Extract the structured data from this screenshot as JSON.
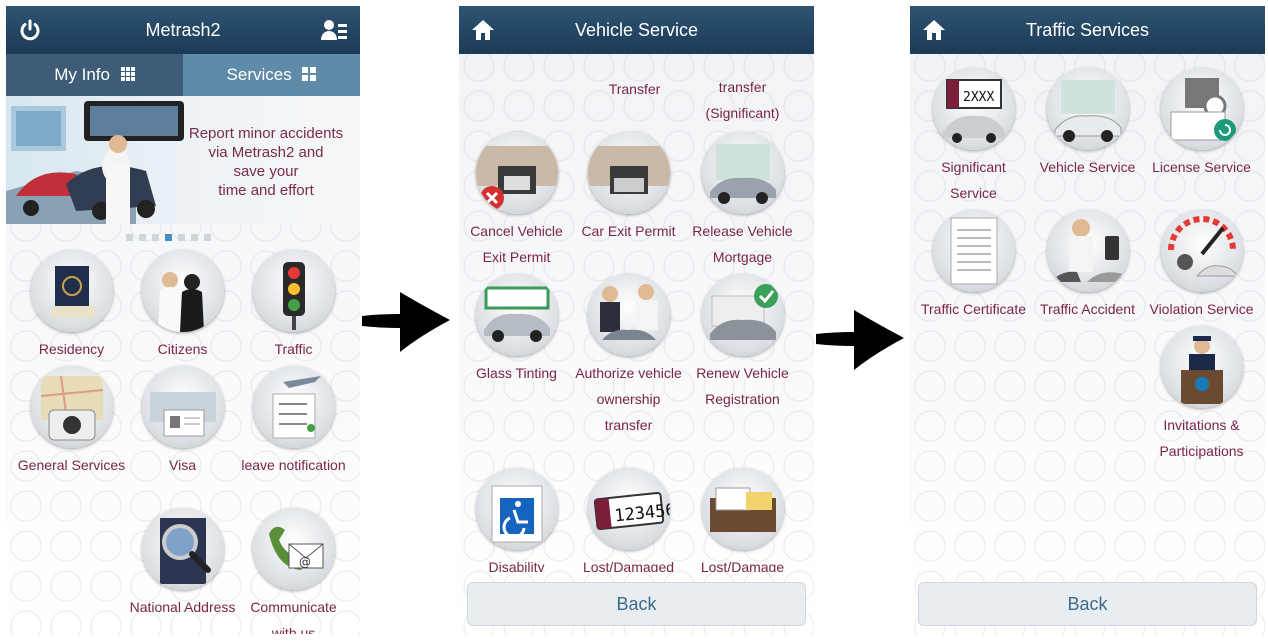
{
  "screen1": {
    "title": "Metrash2",
    "tabs": [
      {
        "label": "My Info"
      },
      {
        "label": "Services"
      }
    ],
    "banner": {
      "text_lines": [
        "Report minor accidents",
        "via Metrash2 and",
        "save your",
        "time and effort"
      ]
    },
    "items": [
      {
        "label": "Residency"
      },
      {
        "label": "Citizens"
      },
      {
        "label": "Traffic"
      },
      {
        "label": "General Services"
      },
      {
        "label": "Visa"
      },
      {
        "label": "leave notification"
      },
      {
        "label": "National Address"
      },
      {
        "label": "Communicate with us"
      }
    ]
  },
  "screen2": {
    "title": "Vehicle Service",
    "top_partial": [
      "Transfer",
      "transfer (Significant)"
    ],
    "items": [
      {
        "label": "Cancel Vehicle Exit Permit"
      },
      {
        "label": "Car Exit Permit"
      },
      {
        "label": "Release Vehicle Mortgage"
      },
      {
        "label": "Glass Tinting"
      },
      {
        "label": "Authorize vehicle ownership transfer"
      },
      {
        "label": "Renew Vehicle Registration"
      },
      {
        "label": "Disability"
      },
      {
        "label": "Lost/Damaged"
      },
      {
        "label": "Lost/Damage"
      }
    ],
    "back_label": "Back"
  },
  "screen3": {
    "title": "Traffic Services",
    "items": [
      {
        "label": "Significant Service"
      },
      {
        "label": "Vehicle Service"
      },
      {
        "label": "License Service"
      },
      {
        "label": "Traffic Certificate"
      },
      {
        "label": "Traffic Accident"
      },
      {
        "label": "Violation Service"
      },
      {
        "label": "Invitations & Participations"
      }
    ],
    "plate_text": "2XXX",
    "back_label": "Back"
  },
  "colors": {
    "header": "#1f415f",
    "label": "#7a2548",
    "tab_active": "#3e5c77",
    "tab_inactive": "#5f8aa8"
  }
}
